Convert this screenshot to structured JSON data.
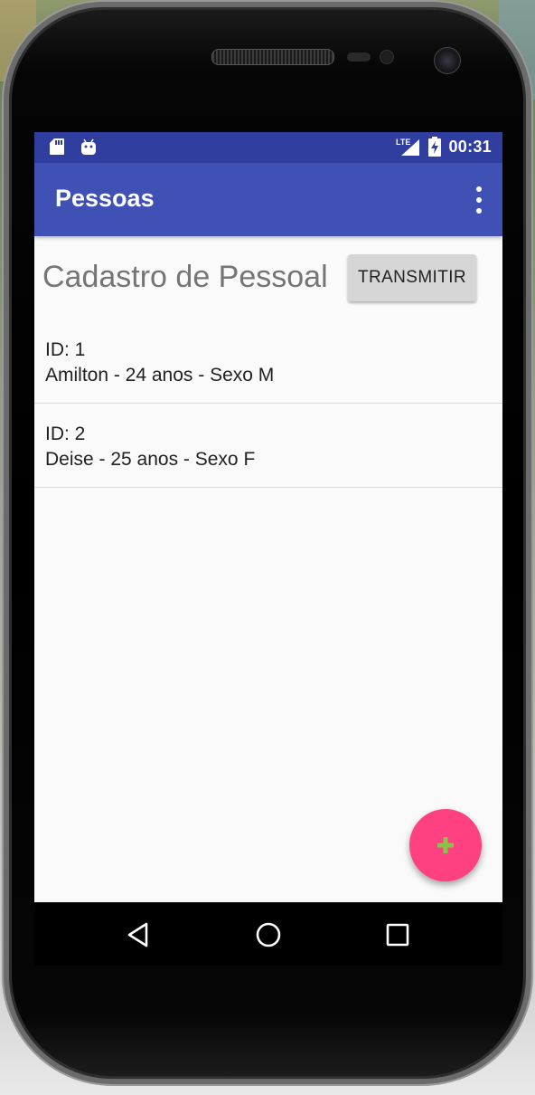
{
  "status_bar": {
    "time": "00:31",
    "network": "LTE",
    "left_icons": [
      "sd-card-icon",
      "android-icon"
    ],
    "right_icons": [
      "lte-signal-icon",
      "battery-charging-icon"
    ]
  },
  "toolbar": {
    "title": "Pessoas",
    "overflow_icon": "more-vertical-icon"
  },
  "main": {
    "title": "Cadastro de Pessoal",
    "transmit_button": "TRANSMITIR",
    "people": [
      {
        "id_line": "ID: 1",
        "details": "Amilton - 24 anos - Sexo M"
      },
      {
        "id_line": "ID: 2",
        "details": "Deise - 25 anos - Sexo F"
      }
    ]
  },
  "fab": {
    "icon": "plus-icon",
    "label": "+"
  },
  "navigation": {
    "buttons": [
      "back-icon",
      "home-icon",
      "recents-icon"
    ]
  },
  "colors": {
    "status_bar": "#303f9f",
    "toolbar": "#3f51b5",
    "fab": "#ff4081",
    "fab_icon": "#8bc34a"
  }
}
